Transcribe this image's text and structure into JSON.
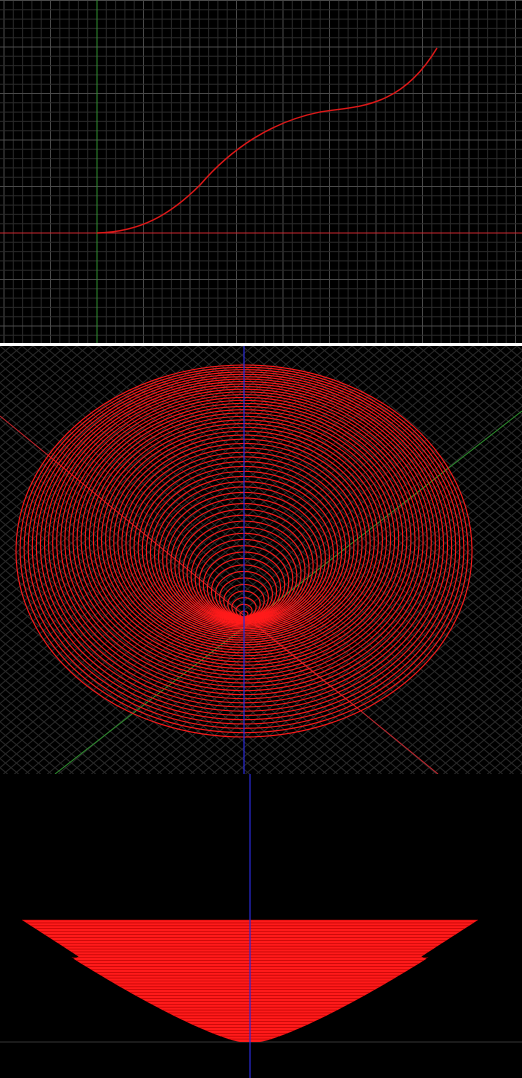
{
  "colors": {
    "background": "#000000",
    "grid_minor": "#2a2a2a",
    "grid_major": "#4a4a4a",
    "axis_x": "#c8262e",
    "axis_y": "#2f8f2f",
    "axis_z": "#2a2ad8",
    "curve": "#e01818",
    "rings": "#ff1a1a",
    "separator": "#ffffff"
  },
  "viewports": {
    "top": {
      "view": "profile-curve",
      "has_grid": true,
      "curve_icon": "s-curve"
    },
    "iso": {
      "view": "isometric-rings",
      "has_grid": true,
      "ring_count": 55
    },
    "side": {
      "view": "side-rings",
      "has_grid": false,
      "ring_count": 42
    }
  }
}
